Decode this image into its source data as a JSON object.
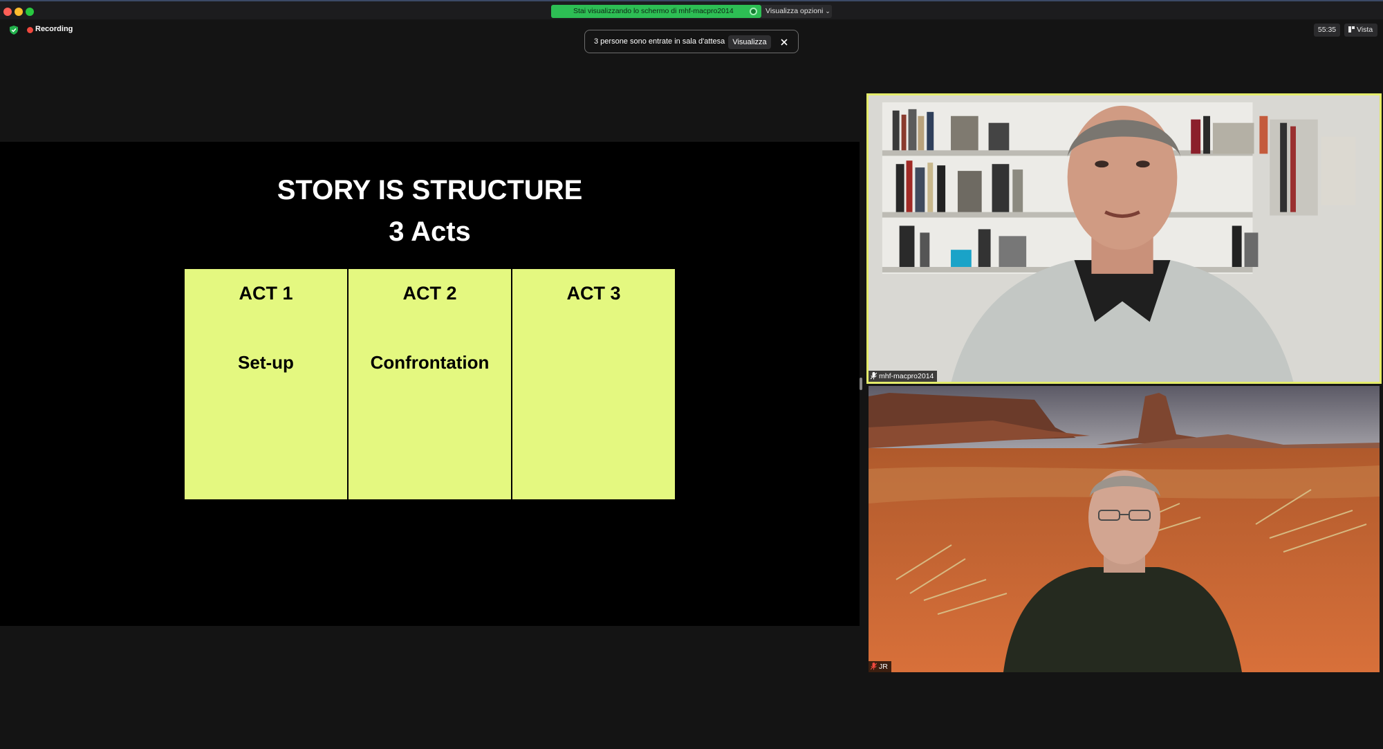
{
  "window": {
    "share_banner": "Stai visualizzando lo schermo di mhf-macpro2014",
    "view_options": "Visualizza opzioni",
    "recording_label": "Recording",
    "timer": "55:35",
    "view_button": "Vista"
  },
  "notification": {
    "message": "3 persone sono entrate in sala d'attesa",
    "action_label": "Visualizza"
  },
  "slide": {
    "title": "STORY IS STRUCTURE",
    "subtitle": "3 Acts",
    "acts": [
      {
        "title": "ACT 1",
        "description": "Set-up"
      },
      {
        "title": "ACT 2",
        "description": "Confrontation"
      },
      {
        "title": "ACT 3",
        "description": ""
      }
    ],
    "box_color": "#e4f880"
  },
  "participants": [
    {
      "name": "mhf-macpro2014",
      "active_speaker": true
    },
    {
      "name": "JR",
      "active_speaker": false
    }
  ],
  "colors": {
    "recording": "#f0483e",
    "share_banner": "#2dbe54",
    "active_speaker_border": "#e4ec6a"
  }
}
